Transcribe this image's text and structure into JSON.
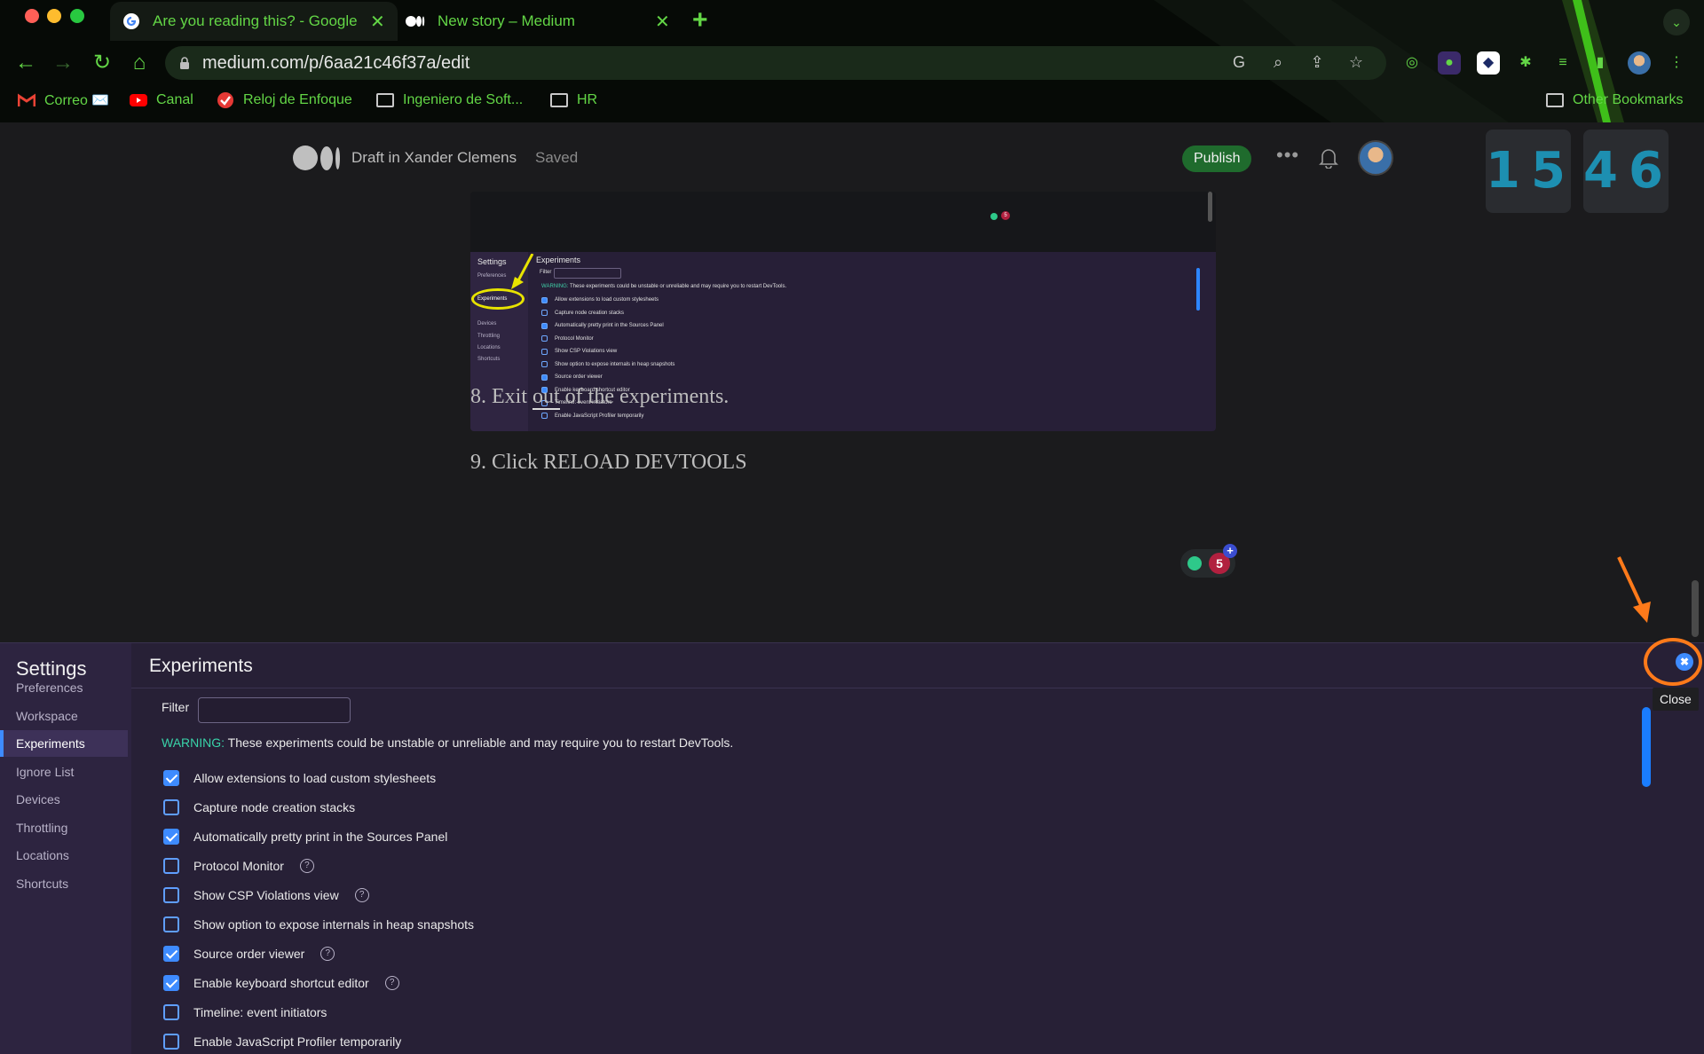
{
  "browser": {
    "tabs": [
      {
        "title": "Are you reading this? - Google",
        "active": true
      },
      {
        "title": "New story – Medium",
        "active": false
      }
    ],
    "url": "medium.com/p/6aa21c46f37a/edit",
    "bookmarks": [
      {
        "label": "Correo ✉️"
      },
      {
        "label": "Canal"
      },
      {
        "label": "Reloj de Enfoque"
      },
      {
        "label": "Ingeniero de Soft..."
      },
      {
        "label": "HR"
      }
    ],
    "other_bookmarks": "Other Bookmarks",
    "accent_color": "#63d646"
  },
  "medium": {
    "draft_label": "Draft in Xander Clemens",
    "saved_label": "Saved",
    "publish_label": "Publish",
    "more_label": "•••",
    "clock": {
      "hours": "15",
      "minutes": "46"
    },
    "story_lines": {
      "line8_pre": "8. Exit ",
      "line8_ul": "out",
      "line8_post": " of the experiments.",
      "line9": "9. Click RELOAD DEVTOOLS"
    },
    "badge_count": "5",
    "badge_plus": "+"
  },
  "embedded_screenshot": {
    "dot_count": "5",
    "sidebar_title": "Settings",
    "sidebar_items": [
      "Preferences",
      "Experiments",
      "Devices",
      "Throttling",
      "Locations",
      "Shortcuts"
    ],
    "title": "Experiments",
    "filter_label": "Filter",
    "warning_key": "WARNING:",
    "warning_text": " These experiments could be unstable or unreliable and may require you to restart DevTools.",
    "rows": [
      {
        "label": "Allow extensions to load custom stylesheets",
        "checked": true
      },
      {
        "label": "Capture node creation stacks",
        "checked": false
      },
      {
        "label": "Automatically pretty print in the Sources Panel",
        "checked": true
      },
      {
        "label": "Protocol Monitor",
        "checked": false
      },
      {
        "label": "Show CSP Violations view",
        "checked": false
      },
      {
        "label": "Show option to expose internals in heap snapshots",
        "checked": false
      },
      {
        "label": "Source order viewer",
        "checked": true
      },
      {
        "label": "Enable keyboard shortcut editor",
        "checked": true
      },
      {
        "label": "Timeline: event initiators",
        "checked": false
      },
      {
        "label": "Enable JavaScript Profiler temporarily",
        "checked": false
      }
    ]
  },
  "devtools": {
    "sidebar_title": "Settings",
    "sidebar_items": [
      {
        "label": "Preferences",
        "selected": false
      },
      {
        "label": "Workspace",
        "selected": false
      },
      {
        "label": "Experiments",
        "selected": true
      },
      {
        "label": "Ignore List",
        "selected": false
      },
      {
        "label": "Devices",
        "selected": false
      },
      {
        "label": "Throttling",
        "selected": false
      },
      {
        "label": "Locations",
        "selected": false
      },
      {
        "label": "Shortcuts",
        "selected": false
      }
    ],
    "title": "Experiments",
    "filter_label": "Filter",
    "filter_value": "",
    "warning_key": "WARNING:",
    "warning_text": " These experiments could be unstable or unreliable and may require you to restart DevTools.",
    "experiments": [
      {
        "label": "Allow extensions to load custom stylesheets",
        "checked": true,
        "help": false
      },
      {
        "label": "Capture node creation stacks",
        "checked": false,
        "help": false
      },
      {
        "label": "Automatically pretty print in the Sources Panel",
        "checked": true,
        "help": false
      },
      {
        "label": "Protocol Monitor",
        "checked": false,
        "help": true
      },
      {
        "label": "Show CSP Violations view",
        "checked": false,
        "help": true
      },
      {
        "label": "Show option to expose internals in heap snapshots",
        "checked": false,
        "help": false
      },
      {
        "label": "Source order viewer",
        "checked": true,
        "help": true
      },
      {
        "label": "Enable keyboard shortcut editor",
        "checked": true,
        "help": true
      },
      {
        "label": "Timeline: event initiators",
        "checked": false,
        "help": false
      },
      {
        "label": "Enable JavaScript Profiler temporarily",
        "checked": false,
        "help": false
      }
    ],
    "help_glyph": "?",
    "close_glyph": "✖",
    "close_tooltip": "Close",
    "annotation_color": "#ff7a1a"
  }
}
